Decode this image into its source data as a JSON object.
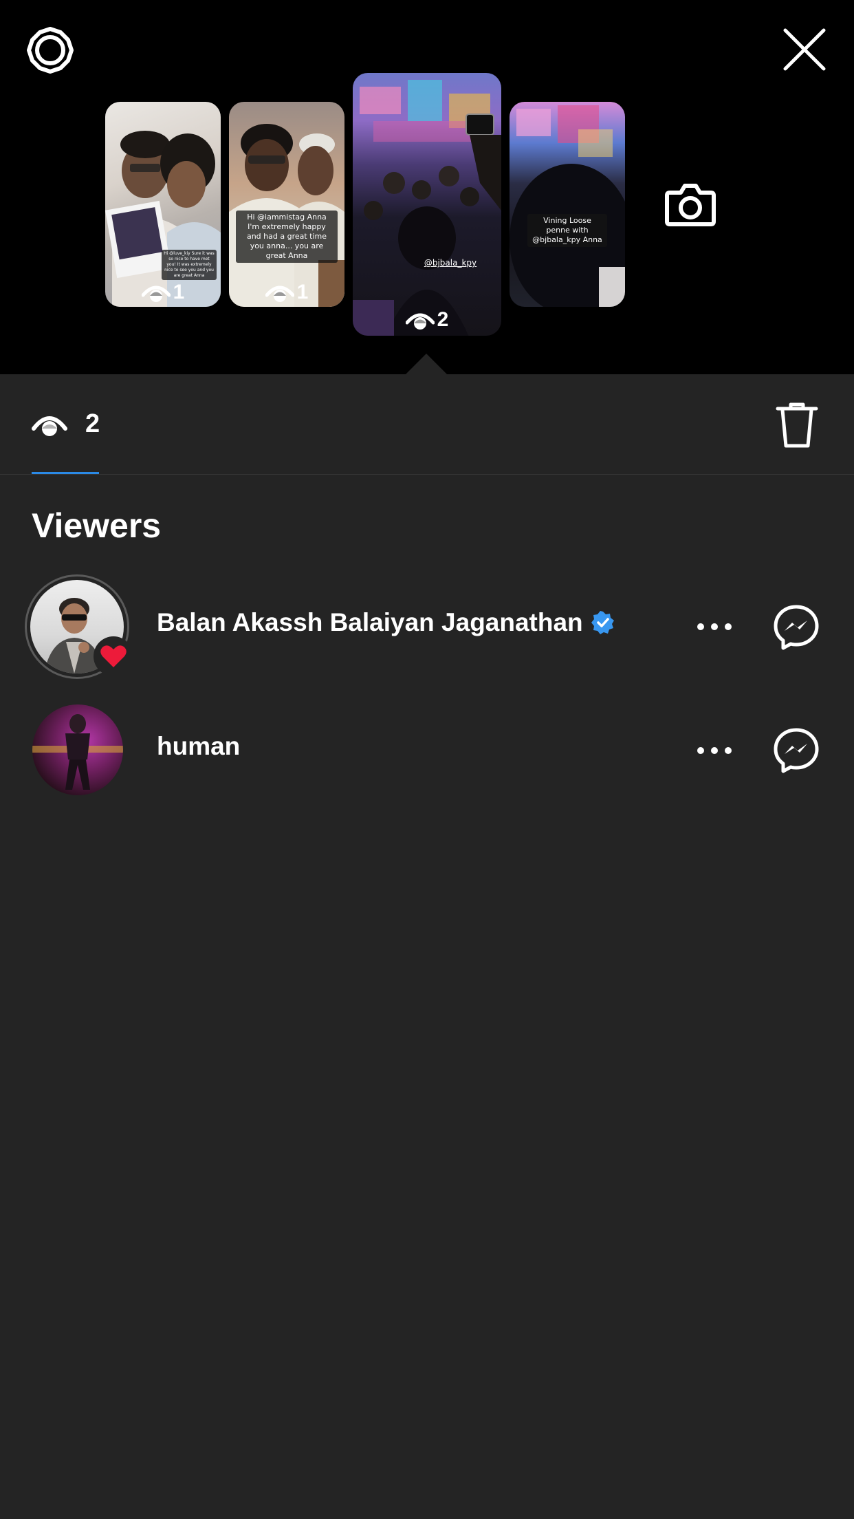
{
  "stories": [
    {
      "caption": "Hi @luve_kiy Sure it was so nice to have met you! It was extremely nice to see you and you are great Anna",
      "views": "1"
    },
    {
      "caption": "Hi @iammistag Anna I'm extremely happy and had a great time you anna... you are great Anna",
      "views": "1"
    },
    {
      "caption": "@bjbala_kpy",
      "views": "2"
    },
    {
      "caption": "Vining Loose penne with @bjbala_kpy Anna",
      "views": ""
    }
  ],
  "selected_views": "2",
  "section_title": "Viewers",
  "viewers": [
    {
      "name": "Balan Akassh Balaiyan Jaganathan",
      "verified": true,
      "liked": true
    },
    {
      "name": "human",
      "verified": false,
      "liked": false
    }
  ],
  "icons": {
    "settings": "settings-gear-icon",
    "close": "close-icon",
    "camera": "camera-icon",
    "eye": "eye-icon",
    "trash": "trash-icon",
    "more": "more-dots-icon",
    "messenger": "messenger-icon",
    "verified": "verified-badge-icon",
    "heart": "heart-icon"
  },
  "colors": {
    "background": "#242424",
    "top_background": "#000000",
    "accent": "#2b8ae6",
    "verified": "#3897f0",
    "heart": "#ed1b3a"
  }
}
